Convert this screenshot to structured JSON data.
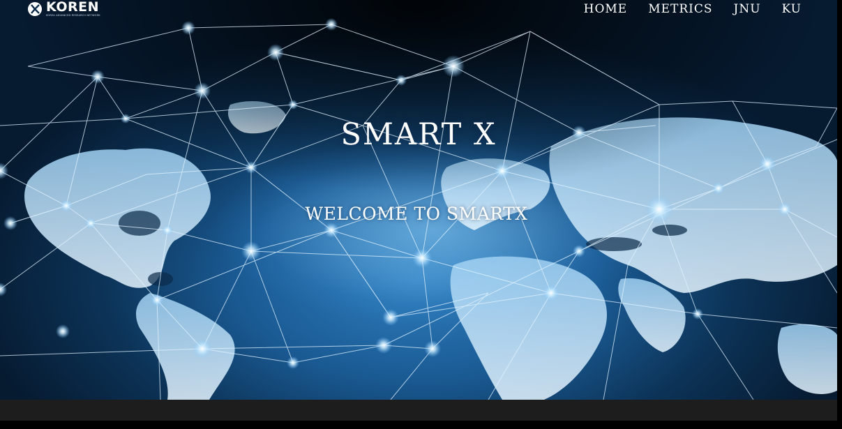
{
  "brand": {
    "name": "KOREN",
    "tagline": "KOREA ADVANCED RESEARCH NETWORK",
    "logo_icon": "koren-logo-icon"
  },
  "nav": {
    "items": [
      {
        "label": "HOME"
      },
      {
        "label": "METRICS"
      },
      {
        "label": "JNU"
      },
      {
        "label": "KU"
      }
    ]
  },
  "hero": {
    "title": "SMART X",
    "subtitle": "WELCOME TO SMARTX",
    "background": "world-network-map",
    "colors": {
      "deep": "#061a30",
      "mid": "#1a5a93",
      "glow": "#9fd8ff"
    }
  }
}
